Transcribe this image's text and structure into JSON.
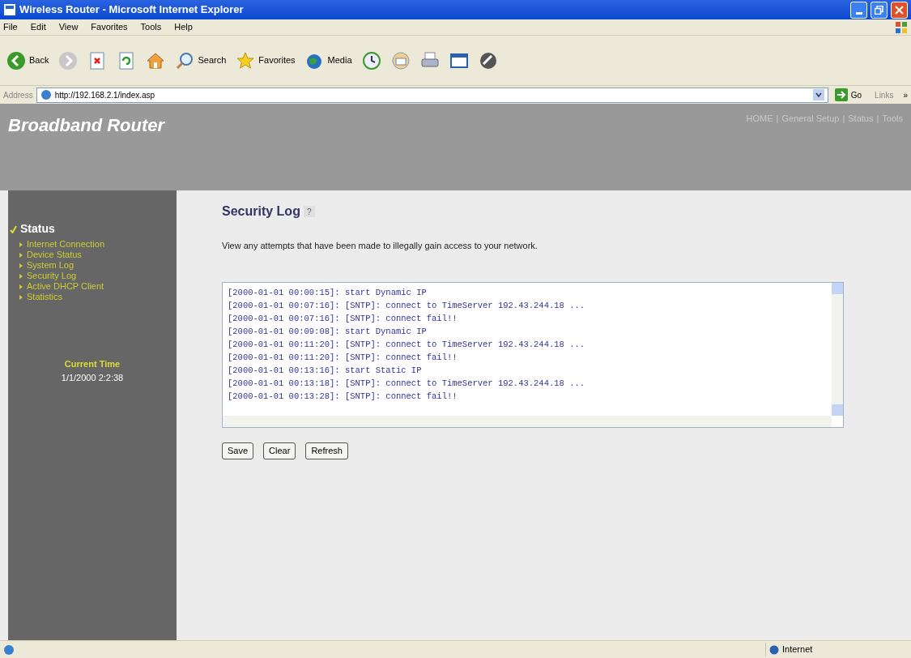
{
  "window": {
    "title": "Wireless Router - Microsoft Internet Explorer"
  },
  "menu": [
    "File",
    "Edit",
    "View",
    "Favorites",
    "Tools",
    "Help"
  ],
  "toolbar": [
    {
      "kind": "back",
      "label": "Back"
    },
    {
      "kind": "forward"
    },
    {
      "kind": "stop"
    },
    {
      "kind": "refresh"
    },
    {
      "kind": "home"
    },
    {
      "kind": "search",
      "label": "Search"
    },
    {
      "kind": "favorites",
      "label": "Favorites"
    },
    {
      "kind": "media",
      "label": "Media"
    },
    {
      "kind": "history"
    },
    {
      "kind": "mail"
    },
    {
      "kind": "print"
    },
    {
      "kind": "edit"
    },
    {
      "kind": "messenger"
    }
  ],
  "address_bar": {
    "label": "Address",
    "url": "http://192.168.2.1/index.asp",
    "go": "Go",
    "links": "Links",
    "more": "»"
  },
  "header": {
    "title": "Broadband Router",
    "nav": [
      "HOME",
      "General Setup",
      "Status",
      "Tools"
    ],
    "separator": "|"
  },
  "sidebar": {
    "section": "Status",
    "items": [
      "Internet Connection",
      "Device Status",
      "System Log",
      "Security Log",
      "Active DHCP Client",
      "Statistics"
    ],
    "time_label": "Current Time",
    "time_value": "1/1/2000 2:2:38"
  },
  "content": {
    "title": "Security Log",
    "help": "?",
    "description": "View any attempts that have been made to illegally gain access to your network.",
    "log": [
      "[2000-01-01 00:00:15]: start Dynamic IP",
      "[2000-01-01 00:07:16]: [SNTP]: connect to TimeServer 192.43.244.18 ...",
      "[2000-01-01 00:07:16]: [SNTP]: connect fail!!",
      "[2000-01-01 00:09:08]: start Dynamic IP",
      "[2000-01-01 00:11:20]: [SNTP]: connect to TimeServer 192.43.244.18 ...",
      "[2000-01-01 00:11:20]: [SNTP]: connect fail!!",
      "[2000-01-01 00:13:16]: start Static IP",
      "[2000-01-01 00:13:18]: [SNTP]: connect to TimeServer 192.43.244.18 ...",
      "[2000-01-01 00:13:28]: [SNTP]: connect fail!!"
    ],
    "buttons": [
      "Save",
      "Clear",
      "Refresh"
    ]
  },
  "status_bar": {
    "zone": "Internet"
  }
}
